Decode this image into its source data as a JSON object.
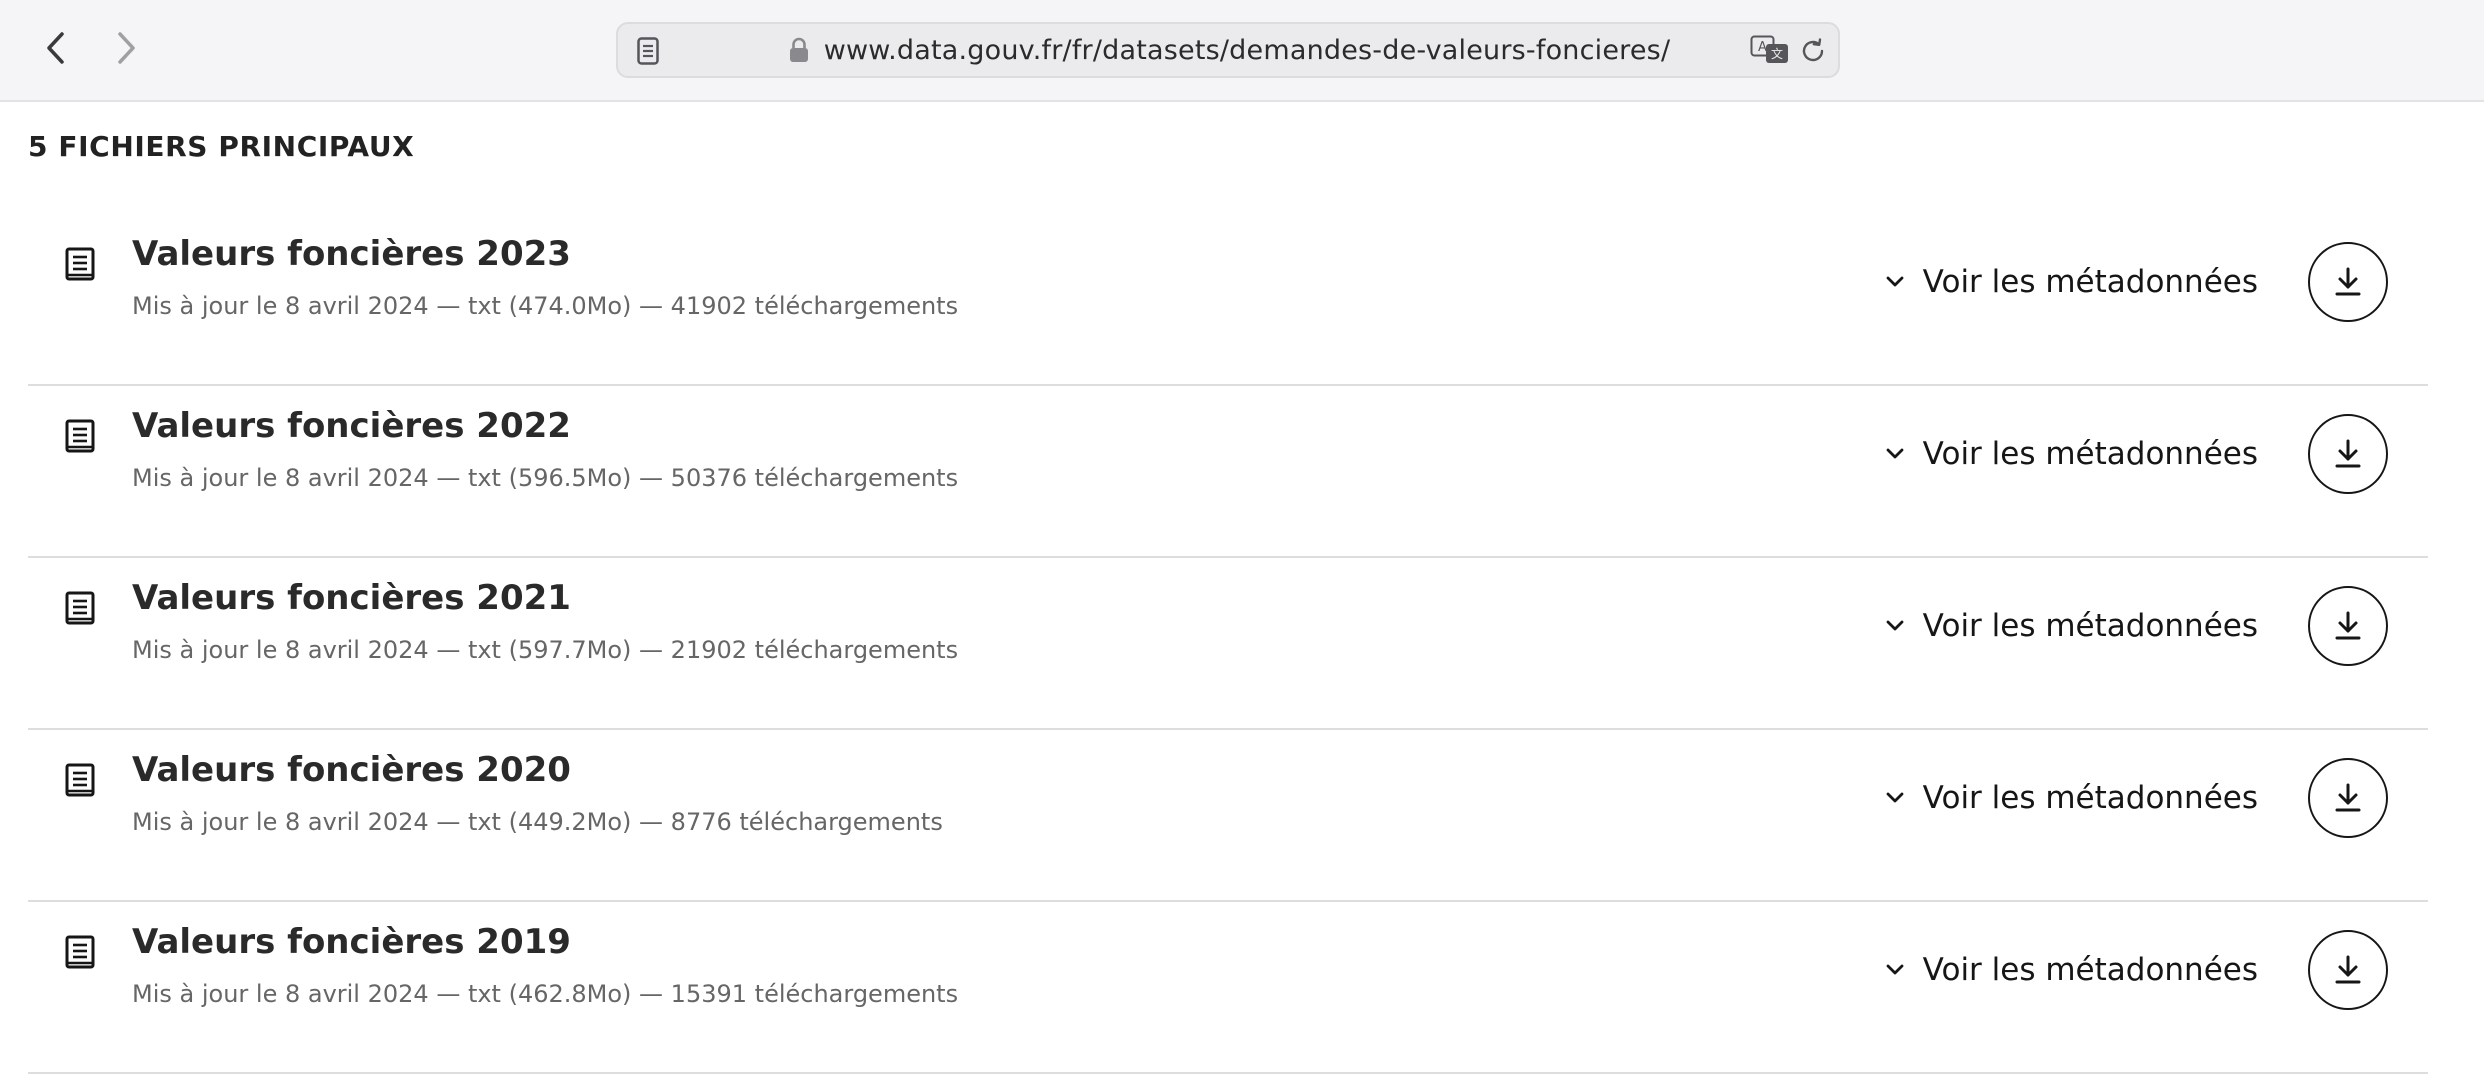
{
  "browser": {
    "url": "www.data.gouv.fr/fr/datasets/demandes-de-valeurs-foncieres/",
    "icons": {
      "back": "chevron-left-icon",
      "forward": "chevron-right-icon",
      "reader": "reader-icon",
      "lock": "lock-icon",
      "translate": "translate-icon",
      "reload": "reload-icon"
    }
  },
  "section": {
    "title": "5 FICHIERS PRINCIPAUX"
  },
  "files": [
    {
      "title": "Valeurs foncières 2023",
      "meta": "Mis à jour le 8 avril 2024 — txt (474.0Mo) — 41902 téléchargements",
      "metadata_label": "Voir les métadonnées"
    },
    {
      "title": "Valeurs foncières 2022",
      "meta": "Mis à jour le 8 avril 2024 — txt (596.5Mo) — 50376 téléchargements",
      "metadata_label": "Voir les métadonnées"
    },
    {
      "title": "Valeurs foncières 2021",
      "meta": "Mis à jour le 8 avril 2024 — txt (597.7Mo) — 21902 téléchargements",
      "metadata_label": "Voir les métadonnées"
    },
    {
      "title": "Valeurs foncières 2020",
      "meta": "Mis à jour le 8 avril 2024 — txt (449.2Mo) — 8776 téléchargements",
      "metadata_label": "Voir les métadonnées"
    },
    {
      "title": "Valeurs foncières 2019",
      "meta": "Mis à jour le 8 avril 2024 — txt (462.8Mo) — 15391 téléchargements",
      "metadata_label": "Voir les métadonnées"
    }
  ],
  "icons": {
    "file": "document-icon",
    "chevron": "chevron-down-icon",
    "download": "download-icon"
  }
}
